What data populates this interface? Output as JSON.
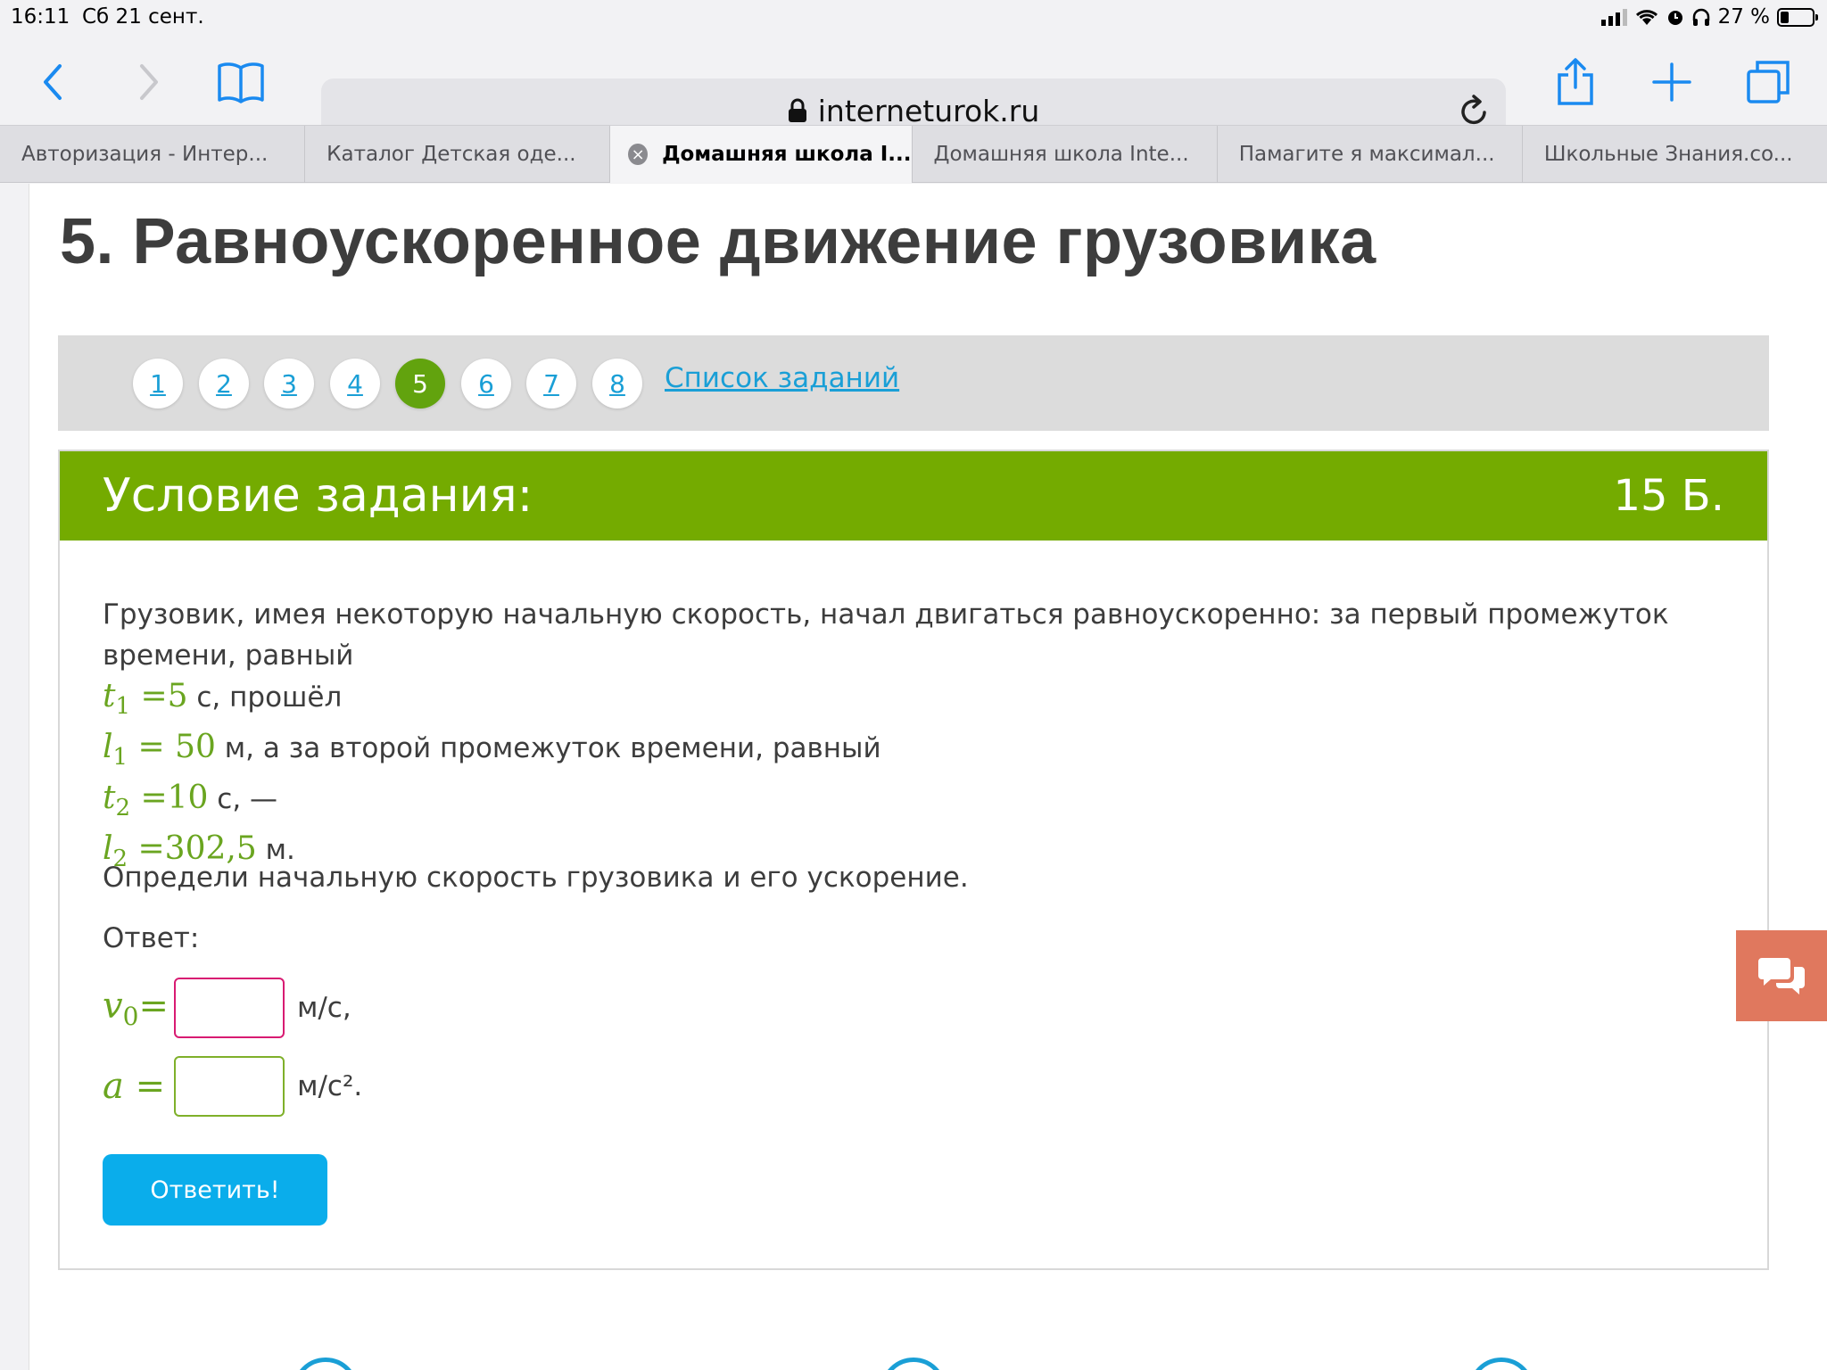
{
  "status_bar": {
    "time": "16:11",
    "date": "Сб 21 сент.",
    "battery": "27 %"
  },
  "browser": {
    "url": "interneturok.ru",
    "tabs": [
      {
        "label": "Авторизация - Интер..."
      },
      {
        "label": "Каталог Детская оде..."
      },
      {
        "label": "Домашняя школа I..."
      },
      {
        "label": "Домашняя школа Inte..."
      },
      {
        "label": "Памагите я максимал..."
      },
      {
        "label": "Школьные Знания.co..."
      }
    ],
    "active_tab_index": 2
  },
  "page": {
    "title": "5. Равноускоренное движение грузовика",
    "task_nav": {
      "items": [
        "1",
        "2",
        "3",
        "4",
        "5",
        "6",
        "7",
        "8"
      ],
      "current": "5",
      "list_link": "Список заданий"
    },
    "task": {
      "header": "Условие задания:",
      "points": "15 Б.",
      "intro": "Грузовик, имея некоторую начальную скорость, начал двигаться равноускоренно: за первый промежуток времени, равный",
      "lines": [
        {
          "var": "t",
          "sub": "1",
          "eq": " =5",
          "text": " с, прошёл"
        },
        {
          "var": "l",
          "sub": "1",
          "eq": " = 50",
          "text": " м, а за второй промежуток времени, равный"
        },
        {
          "var": "t",
          "sub": "2",
          "eq": " =10",
          "text": " с, —"
        },
        {
          "var": "l",
          "sub": "2",
          "eq": " =302,5",
          "text": " м."
        }
      ],
      "question": "Определи начальную скорость грузовика и его ускорение.",
      "answer_label": "Ответ:",
      "answers": [
        {
          "var": "v",
          "sub": "0",
          "eq": "=",
          "value": "",
          "unit": "м/с,",
          "border_color": "#d81b72"
        },
        {
          "var": "a",
          "sub": "",
          "eq": " =",
          "value": "",
          "unit": "м/с².",
          "border_color": "#7fb02a"
        }
      ],
      "submit_label": "Ответить!"
    }
  },
  "colors": {
    "accent_green": "#74ab00",
    "link_blue": "#1a9fd6",
    "button_blue": "#0aadeb",
    "chat_orange": "#e0785e"
  }
}
